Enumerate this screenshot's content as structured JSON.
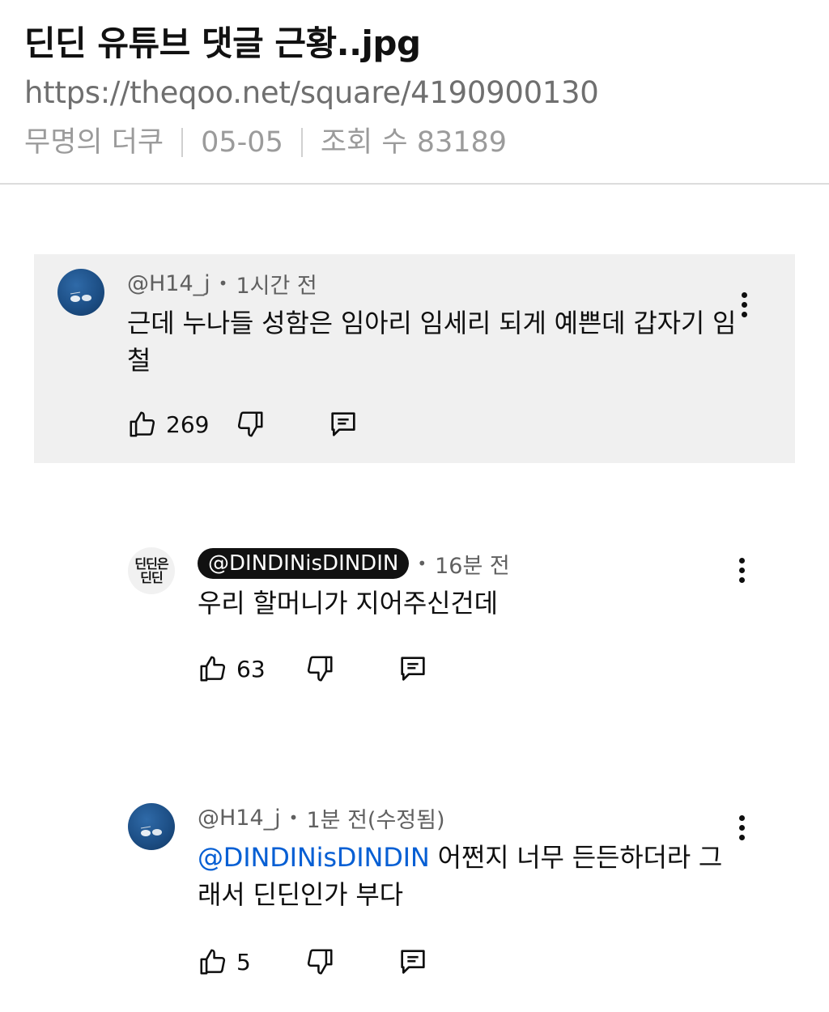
{
  "post": {
    "title": "딘딘 유튜브 댓글 근황..jpg",
    "url": "https://theqoo.net/square/4190900130",
    "author": "무명의 더쿠",
    "date": "05-05",
    "views": "조회 수 83189"
  },
  "comments": [
    {
      "handle": "@H14_j",
      "time": "1시간 전",
      "text": "근데 누나들 성함은 임아리 임세리 되게 예쁜데 갑자기 임철",
      "likes": "269",
      "avatar": "sea-bird-avatar",
      "highlighted": true
    },
    {
      "handle": "@DINDINisDINDIN",
      "time": "16분 전",
      "text": "우리 할머니가 지어주신건데",
      "likes": "63",
      "avatar_text": "딘딘은\n딘딘",
      "creator": true
    },
    {
      "handle": "@H14_j",
      "time": "1분 전(수정됨)",
      "mention": "@DINDINisDINDIN",
      "text": " 어쩐지 너무 든든하더라 그래서 딘딘인가 부다",
      "likes": "5",
      "avatar": "sea-bird-avatar"
    }
  ],
  "colors": {
    "mention": "#065fd4",
    "highlight_bg": "#f0f0f0",
    "creator_pill": "#111111"
  },
  "icons": {
    "like": "thumbs-up-icon",
    "dislike": "thumbs-down-icon",
    "reply": "reply-comment-icon",
    "menu": "kebab-menu-icon"
  }
}
